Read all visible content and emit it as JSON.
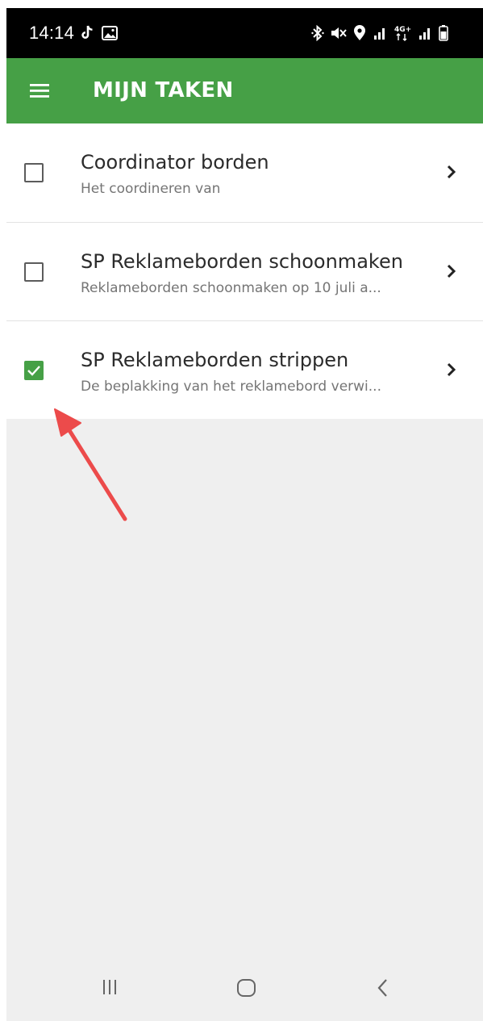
{
  "status_bar": {
    "time": "14:14",
    "left_icons": [
      "tiktok-icon",
      "gallery-icon"
    ],
    "right_icons": [
      "bluetooth-icon",
      "mute-icon",
      "location-icon",
      "signal-icon",
      "network-4g-icon",
      "signal-icon",
      "battery-icon"
    ]
  },
  "app_bar": {
    "title": "MIJN TAKEN",
    "menu_icon": "hamburger-menu-icon",
    "color": "#46a046"
  },
  "tasks": [
    {
      "title": "Coordinator borden",
      "subtitle": "Het coordineren van",
      "checked": false
    },
    {
      "title": "SP Reklameborden schoonmaken",
      "subtitle": "Reklameborden schoonmaken op 10 juli a...",
      "checked": false
    },
    {
      "title": "SP Reklameborden strippen",
      "subtitle": "De beplakking van het reklamebord verwi...",
      "checked": true
    }
  ],
  "annotation": {
    "icon": "red-arrow-icon",
    "color": "#ec4b4b"
  },
  "nav_bar": {
    "buttons": [
      "recent-apps-icon",
      "home-icon",
      "back-icon"
    ]
  }
}
